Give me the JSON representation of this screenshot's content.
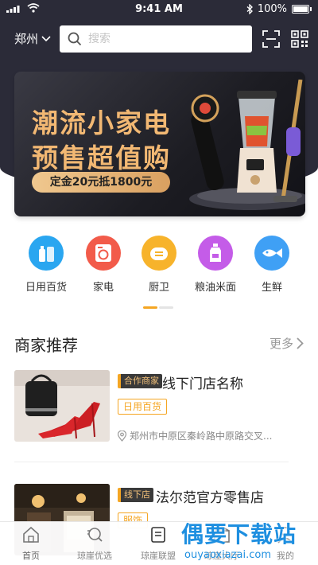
{
  "status_bar": {
    "time": "9:41 AM",
    "battery": "100%"
  },
  "header": {
    "location": "郑州",
    "search_placeholder": "搜索"
  },
  "banner": {
    "line1": "潮流小家电",
    "line2": "预售超值购",
    "promo": "定金20元抵1800元"
  },
  "categories": [
    {
      "label": "日用百货",
      "icon": "daily-goods-icon",
      "color": "#2aa6f0"
    },
    {
      "label": "家电",
      "icon": "appliance-icon",
      "color": "#f25b4a"
    },
    {
      "label": "厨卫",
      "icon": "kitchen-icon",
      "color": "#f7b32b"
    },
    {
      "label": "粮油米面",
      "icon": "grain-oil-icon",
      "color": "#c45ce8"
    },
    {
      "label": "生鲜",
      "icon": "fresh-fish-icon",
      "color": "#3fa0f5"
    }
  ],
  "merchants": {
    "title": "商家推荐",
    "more": "更多",
    "stores": [
      {
        "badge": "合作商家",
        "name": "线下门店名称",
        "tag": "日用百货",
        "address": "郑州市中原区秦岭路中原路交叉..."
      },
      {
        "badge": "线下店",
        "name": "法尔范官方零售店",
        "tag": "服饰"
      }
    ]
  },
  "tab_bar": {
    "tabs": [
      {
        "label": "首页",
        "icon": "home-icon"
      },
      {
        "label": "琼崖优选",
        "icon": "search-star-icon"
      },
      {
        "label": "琼崖联盟",
        "icon": "alliance-icon"
      },
      {
        "label": "琼崖大厅",
        "icon": "hall-icon"
      },
      {
        "label": "我的",
        "icon": "profile-icon"
      }
    ]
  },
  "watermark": {
    "title": "偶要下载站",
    "url": "ouyaoxiazai.com"
  },
  "colors": {
    "header_bg": "#2b2b38",
    "accent": "#f5a623",
    "banner_gold": "#f2b873",
    "watermark": "#1e8fe0"
  }
}
